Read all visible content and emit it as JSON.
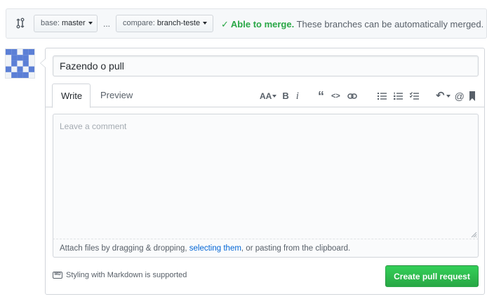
{
  "compare_bar": {
    "base_prefix": "base:",
    "base_branch": "master",
    "ellipsis": "...",
    "compare_prefix": "compare:",
    "compare_branch": "branch-teste",
    "merge_ok": "Able to merge.",
    "merge_message": "These branches can be automatically merged."
  },
  "form": {
    "title_value": "Fazendo o pull",
    "tabs": [
      "Write",
      "Preview"
    ],
    "toolbar": {
      "header": "AA",
      "bold": "B",
      "italic": "i",
      "quote": "“",
      "code": "<>",
      "link": "⊕",
      "bullet_list": "≡",
      "numbered_list": "≡",
      "task_list": "≡",
      "reply": "↶",
      "mention": "@",
      "bookmark": "▮"
    },
    "comment_placeholder": "Leave a comment",
    "attach_prefix": "Attach files by dragging & dropping, ",
    "attach_link": "selecting them",
    "attach_suffix": ", or pasting from the clipboard.",
    "markdown_note": "Styling with Markdown is supported",
    "markdown_icon_label": "MD",
    "submit_label": "Create pull request"
  },
  "colors": {
    "success_green": "#28a745",
    "link_blue": "#0366d6",
    "avatar_blue": "#5b7fd6"
  }
}
